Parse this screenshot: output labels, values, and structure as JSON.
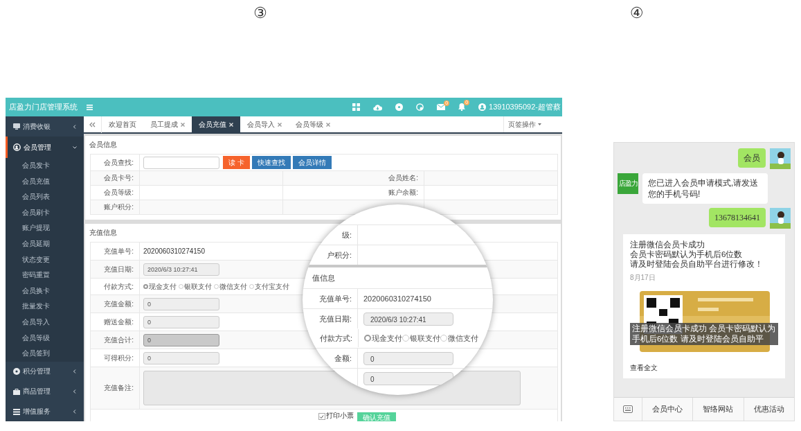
{
  "step_labels": [
    "③",
    "④"
  ],
  "admin": {
    "app_title": "店盈力门店管理系统",
    "header_icons": [
      {
        "kind": "grid"
      },
      {
        "kind": "cloud"
      },
      {
        "kind": "disc"
      },
      {
        "kind": "globe"
      },
      {
        "kind": "mail",
        "badge": "0"
      },
      {
        "kind": "bell",
        "badge": "0"
      }
    ],
    "user": "13910395092-超管蔡",
    "sidebar": [
      {
        "label": "消费收银",
        "kind": "cashier",
        "expanded": false
      },
      {
        "label": "会员管理",
        "kind": "member",
        "expanded": true,
        "children": [
          {
            "label": "会员发卡"
          },
          {
            "label": "会员充值"
          },
          {
            "label": "会员列表"
          },
          {
            "label": "会员刷卡"
          },
          {
            "label": "账户提现"
          },
          {
            "label": "会员延期"
          },
          {
            "label": "状态变更"
          },
          {
            "label": "密码重置"
          },
          {
            "label": "会员换卡"
          },
          {
            "label": "批量发卡"
          },
          {
            "label": "会员导入"
          },
          {
            "label": "会员等级"
          },
          {
            "label": "会员签到"
          }
        ]
      },
      {
        "label": "积分管理",
        "kind": "points",
        "expanded": false
      },
      {
        "label": "商品管理",
        "kind": "bag",
        "expanded": false
      },
      {
        "label": "增值服务",
        "kind": "service",
        "expanded": false
      }
    ],
    "tabs": [
      {
        "label": "欢迎首页",
        "closable": false,
        "selected": false
      },
      {
        "label": "员工提成",
        "closable": true,
        "selected": false
      },
      {
        "label": "会员充值",
        "closable": true,
        "selected": true
      },
      {
        "label": "会员导入",
        "closable": true,
        "selected": false
      },
      {
        "label": "会员等级",
        "closable": true,
        "selected": false
      }
    ],
    "tab_menu": "页签操作",
    "member_info": {
      "title": "会员信息",
      "search_label": "会员查找:",
      "buttons": [
        {
          "label": "读 卡",
          "kind": "warning"
        },
        {
          "label": "快速查找",
          "kind": "primary"
        },
        {
          "label": "会员详情",
          "kind": "primary"
        }
      ],
      "rows": [
        {
          "left": "会员卡号:",
          "right": "会员姓名:"
        },
        {
          "left": "会员等级:",
          "right": "账户余额:"
        },
        {
          "left": "账户积分:"
        }
      ]
    },
    "recharge": {
      "title": "充值信息",
      "rows": [
        {
          "kind": "text",
          "label": "充值单号:",
          "value": "2020060310274150"
        },
        {
          "kind": "input",
          "label": "充值日期:",
          "value": "2020/6/3 10:27:41",
          "disabled": false
        },
        {
          "kind": "radio",
          "label": "付款方式:",
          "options": [
            {
              "label": "现金支付",
              "selected": true
            },
            {
              "label": "银联支付",
              "selected": false
            },
            {
              "label": "微信支付",
              "selected": false
            },
            {
              "label": "支付宝支付",
              "selected": false
            }
          ]
        },
        {
          "kind": "input",
          "label": "充值金额:",
          "value": "0",
          "disabled": false
        },
        {
          "kind": "input",
          "label": "赠送金额:",
          "value": "0",
          "disabled": false
        },
        {
          "kind": "input",
          "label": "充值合计:",
          "value": "0",
          "disabled": true
        },
        {
          "kind": "input",
          "label": "可得积分:",
          "value": "0",
          "disabled": false
        },
        {
          "kind": "textarea",
          "label": "充值备注:"
        }
      ],
      "print_receipt": {
        "label": "打印小票",
        "checked": true
      },
      "submit": "确认充值"
    },
    "magnifier": {
      "rows": [
        {
          "kind": "text",
          "label": "级:"
        },
        {
          "kind": "text",
          "label": "户积分:"
        },
        {
          "kind": "section",
          "label": "值信息"
        },
        {
          "kind": "text",
          "label": "充值单号:",
          "value": "2020060310274150"
        },
        {
          "kind": "input",
          "label": "充值日期:",
          "value": "2020/6/3 10:27:41"
        },
        {
          "kind": "radio",
          "label": "付款方式:",
          "options": [
            {
              "label": "现金支付",
              "selected": true
            },
            {
              "label": "银联支付",
              "selected": false
            },
            {
              "label": "微信支付",
              "selected": false
            }
          ]
        },
        {
          "kind": "input",
          "label": "金额:",
          "value": "0"
        },
        {
          "kind": "input",
          "value": "0"
        }
      ]
    }
  },
  "chat": {
    "messages": [
      {
        "kind": "out",
        "text": "会员"
      },
      {
        "kind": "in",
        "sender": "店盈力",
        "text": "您已进入会员申请模式,请发送您的手机号码!"
      },
      {
        "kind": "out",
        "text": "13678134641"
      },
      {
        "kind": "article",
        "lines": [
          "注册微信会员卡成功",
          "会员卡密码默认为手机后6位数",
          "请及时登陆会员自助平台进行修改！"
        ],
        "date": "8月17日",
        "caption": "注册微信会员卡成功  会员卡密码默认为手机后6位数  请及时登陆会员自助平",
        "link": "查看全文"
      }
    ],
    "menu": [
      "会员中心",
      "智络网站",
      "优惠活动"
    ]
  }
}
